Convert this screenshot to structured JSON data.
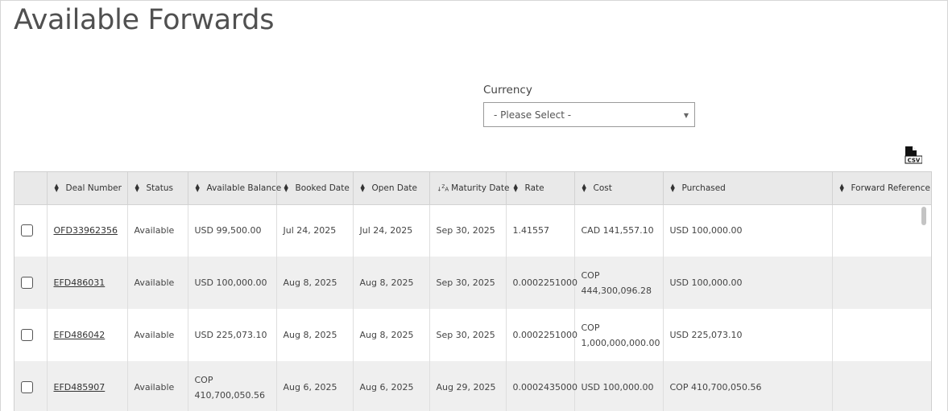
{
  "page": {
    "title": "Available Forwards"
  },
  "filter": {
    "label": "Currency",
    "select_value": "- Please Select -"
  },
  "export": {
    "icon": "csv-file-icon",
    "label": "CSV"
  },
  "table": {
    "columns": [
      {
        "label": "Deal Number",
        "sort": "both"
      },
      {
        "label": "Status",
        "sort": "both"
      },
      {
        "label": "Available Balance",
        "sort": "both"
      },
      {
        "label": "Booked Date",
        "sort": "both"
      },
      {
        "label": "Open Date",
        "sort": "both"
      },
      {
        "label": "Maturity Date",
        "sort": "z-a"
      },
      {
        "label": "Rate",
        "sort": "both"
      },
      {
        "label": "Cost",
        "sort": "both"
      },
      {
        "label": "Purchased",
        "sort": "both"
      },
      {
        "label": "Forward Reference",
        "sort": "both"
      }
    ],
    "rows": [
      {
        "deal": "OFD33962356",
        "status": "Available",
        "available_balance": "USD 99,500.00",
        "booked": "Jul 24, 2025",
        "open": "Jul 24, 2025",
        "maturity": "Sep 30, 2025",
        "rate": "1.41557",
        "cost": "CAD 141,557.10",
        "purchased": "USD 100,000.00",
        "reference": ""
      },
      {
        "deal": "EFD486031",
        "status": "Available",
        "available_balance": "USD 100,000.00",
        "booked": "Aug 8, 2025",
        "open": "Aug 8, 2025",
        "maturity": "Sep 30, 2025",
        "rate": "0.0002251000",
        "cost": "COP 444,300,096.28",
        "purchased": "USD 100,000.00",
        "reference": ""
      },
      {
        "deal": "EFD486042",
        "status": "Available",
        "available_balance": "USD 225,073.10",
        "booked": "Aug 8, 2025",
        "open": "Aug 8, 2025",
        "maturity": "Sep 30, 2025",
        "rate": "0.0002251000",
        "cost": "COP 1,000,000,000.00",
        "purchased": "USD 225,073.10",
        "reference": ""
      },
      {
        "deal": "EFD485907",
        "status": "Available",
        "available_balance": "COP 410,700,050.56",
        "booked": "Aug 6, 2025",
        "open": "Aug 6, 2025",
        "maturity": "Aug 29, 2025",
        "rate": "0.0002435000",
        "cost": "USD 100,000.00",
        "purchased": "COP 410,700,050.56",
        "reference": ""
      }
    ]
  }
}
